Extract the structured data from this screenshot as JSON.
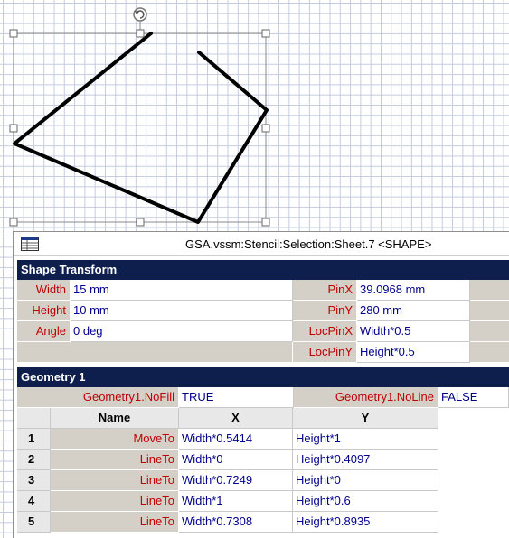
{
  "window": {
    "title": "GSA.vssm:Stencil:Selection:Sheet.7 <SHAPE>"
  },
  "shape_transform": {
    "header": "Shape Transform",
    "width_label": "Width",
    "width_value": "15 mm",
    "height_label": "Height",
    "height_value": "10 mm",
    "angle_label": "Angle",
    "angle_value": "0 deg",
    "pinx_label": "PinX",
    "pinx_value": "39.0968 mm",
    "piny_label": "PinY",
    "piny_value": "280 mm",
    "locpinx_label": "LocPinX",
    "locpinx_value": "Width*0.5",
    "locpiny_label": "LocPinY",
    "locpiny_value": "Height*0.5"
  },
  "geometry": {
    "header": "Geometry 1",
    "nofill_label": "Geometry1.NoFill",
    "nofill_value": "TRUE",
    "noline_label": "Geometry1.NoLine",
    "noline_value": "FALSE",
    "col_name": "Name",
    "col_x": "X",
    "col_y": "Y",
    "rows": [
      {
        "num": "1",
        "name": "MoveTo",
        "x": "Width*0.5414",
        "y": "Height*1"
      },
      {
        "num": "2",
        "name": "LineTo",
        "x": "Width*0",
        "y": "Height*0.4097"
      },
      {
        "num": "3",
        "name": "LineTo",
        "x": "Width*0.7249",
        "y": "Height*0"
      },
      {
        "num": "4",
        "name": "LineTo",
        "x": "Width*1",
        "y": "Height*0.6"
      },
      {
        "num": "5",
        "name": "LineTo",
        "x": "Width*0.7308",
        "y": "Height*0.8935"
      }
    ]
  },
  "colors": {
    "section_header": "#0f1f4d",
    "label_text": "#c00000",
    "value_text": "#00008b",
    "label_bg": "#d4d0c8",
    "grid_line": "#c5cbe0"
  },
  "icons": [
    "rotation-handle-icon",
    "shapesheet-window-icon"
  ]
}
